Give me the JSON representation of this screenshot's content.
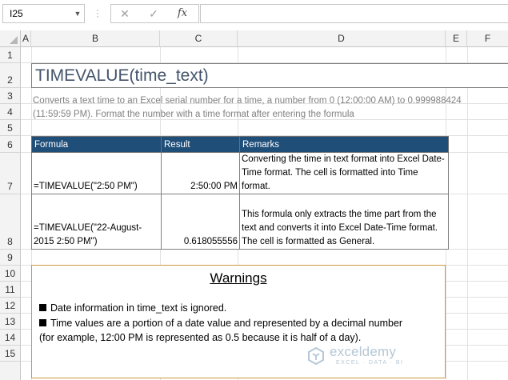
{
  "formula_bar": {
    "name_box": "I25",
    "cancel_icon": "✕",
    "enter_icon": "✓",
    "fx_label": "fx",
    "formula": ""
  },
  "columns": [
    "A",
    "B",
    "C",
    "D",
    "E",
    "F"
  ],
  "rows": [
    "1",
    "2",
    "3",
    "4",
    "5",
    "6",
    "7",
    "8",
    "9",
    "10",
    "11",
    "12",
    "13",
    "14",
    "15"
  ],
  "title": "TIMEVALUE(time_text)",
  "description": {
    "line1": "Converts a text time to an Excel serial number for a time, a number from 0 (12:00:00 AM) to 0.999988424",
    "line2": "(11:59:59 PM). Format the number with a time format after entering the formula"
  },
  "table": {
    "headers": [
      "Formula",
      "Result",
      "Remarks"
    ],
    "rows": [
      {
        "formula": "=TIMEVALUE(\"2:50 PM\")",
        "result": "2:50:00 PM",
        "remarks": "Converting the time in text format into Excel Date-Time format. The cell is formatted into Time format."
      },
      {
        "formula": "=TIMEVALUE(\"22-August-2015 2:50 PM\")",
        "result": "0.618055556",
        "remarks": "This formula only extracts the time part from the text and converts it into Excel Date-Time format. The cell is formatted as General."
      }
    ],
    "header_color": "#1f4e79"
  },
  "warnings": {
    "title": "Warnings",
    "items": [
      "Date information in time_text is ignored.",
      "Time values are a portion of a date value and represented by a decimal number",
      "(for example, 12:00 PM is represented as 0.5 because it is half of a day)."
    ],
    "border_color": "#c89a3c"
  },
  "logo": {
    "name": "exceldemy",
    "tagline": "EXCEL · DATA · BI",
    "icon": "exceldemy-logo-icon"
  },
  "colors": {
    "title_text": "#44546a",
    "description_text": "#808080",
    "logo": "#b5c7d6"
  }
}
